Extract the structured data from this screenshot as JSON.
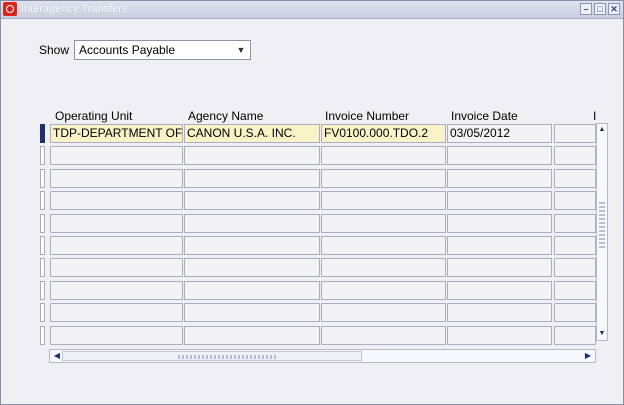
{
  "window": {
    "title": "Interagency Transfers",
    "buttons": {
      "minimize": "–",
      "maximize": "□",
      "close": "✕"
    }
  },
  "filter": {
    "label": "Show",
    "selected": "Accounts Payable",
    "arrow": "▼"
  },
  "table": {
    "columns": [
      "Operating Unit",
      "Agency Name",
      "Invoice Number",
      "Invoice Date",
      "I"
    ],
    "rows": [
      [
        "TDP-DEPARTMENT OF",
        "CANON U.S.A. INC.",
        "FV0100.000.TDO.2",
        "03/05/2012",
        ""
      ],
      [
        "",
        "",
        "",
        "",
        ""
      ],
      [
        "",
        "",
        "",
        "",
        ""
      ],
      [
        "",
        "",
        "",
        "",
        ""
      ],
      [
        "",
        "",
        "",
        "",
        ""
      ],
      [
        "",
        "",
        "",
        "",
        ""
      ],
      [
        "",
        "",
        "",
        "",
        ""
      ],
      [
        "",
        "",
        "",
        "",
        ""
      ],
      [
        "",
        "",
        "",
        "",
        ""
      ],
      [
        "",
        "",
        "",
        "",
        ""
      ]
    ]
  },
  "scrollbars": {
    "up": "▲",
    "down": "▼",
    "left": "◀",
    "right": "▶"
  }
}
